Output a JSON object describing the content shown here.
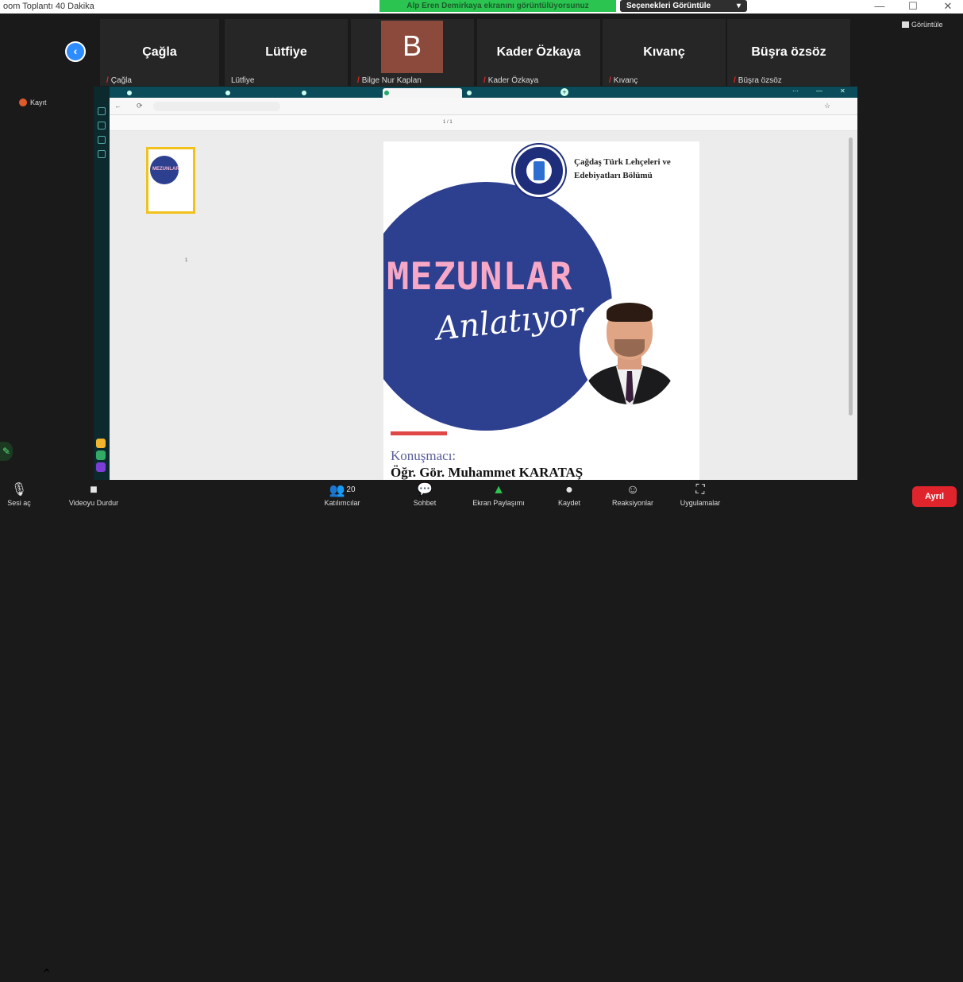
{
  "window": {
    "title": "oom Toplantı 40 Dakika",
    "speaking_banner": "Alp Eren Demirkaya ekranını görüntülüyorsunuz",
    "view_options": "Seçenekleri Görüntüle",
    "chevron": "▾",
    "controls": [
      "—",
      "☐",
      "✕"
    ]
  },
  "participants": {
    "back": "‹",
    "tiles": [
      {
        "name": "Çağla",
        "label": "Çağla",
        "muted": true
      },
      {
        "name": "Lütfiye",
        "label": "Lütfiye",
        "muted": false
      },
      {
        "name": "B",
        "label": "Bilge Nur Kaplan",
        "muted": true
      },
      {
        "name": "Kader Özkaya",
        "label": "Kader Özkaya",
        "muted": true
      },
      {
        "name": "Kıvanç",
        "label": "Kıvanç",
        "muted": true
      },
      {
        "name": "Büşra özsöz",
        "label": "Büşra özsöz",
        "muted": true
      }
    ],
    "mic_glyph": "🎙",
    "view_label": "Görüntüle",
    "record_label": "Kayıt"
  },
  "browser": {
    "tabs": [
      "",
      "",
      "",
      "",
      "",
      ""
    ],
    "new_tab": "+",
    "window_controls": [
      "⋯",
      "—",
      "✕"
    ],
    "url": "",
    "doc_title": "",
    "nav_icons": [
      "←",
      "⟳",
      "☆"
    ],
    "pdf_filename": "",
    "pdf_page": "1 / 1",
    "thumb_title": "MEZUNLAR",
    "thumb_page_no": "1"
  },
  "poster": {
    "department": "Çağdaş Türk Lehçeleri ve Edebiyatları Bölümü",
    "headline": "MEZUNLAR",
    "subheadline": "Anlatıyor",
    "speaker_label": "Konuşmacı:",
    "speaker_name": "Öğr. Gör. Muhammet KARATAŞ"
  },
  "toolbar": {
    "items": [
      {
        "icon": "🎙",
        "label": "Sesi aç"
      },
      {
        "icon": "■",
        "label": "Videoyu Durdur"
      },
      {
        "icon": "👥",
        "label": "Katılımcılar",
        "count": "20"
      },
      {
        "icon": "💬",
        "label": "Sohbet"
      },
      {
        "icon": "▲",
        "label": "Ekran Paylaşımı"
      },
      {
        "icon": "●",
        "label": "Kaydet"
      },
      {
        "icon": "☺",
        "label": "Reaksiyonlar"
      },
      {
        "icon": "⛶",
        "label": "Uygulamalar"
      }
    ],
    "caret": "⌃",
    "leave_label": "Ayrıl",
    "pen_glyph": "✎"
  },
  "colors": {
    "accent": "#2bc451",
    "leave": "#e0242c",
    "poster_blue": "#2d3f8f",
    "poster_pink": "#f7a8c6"
  }
}
